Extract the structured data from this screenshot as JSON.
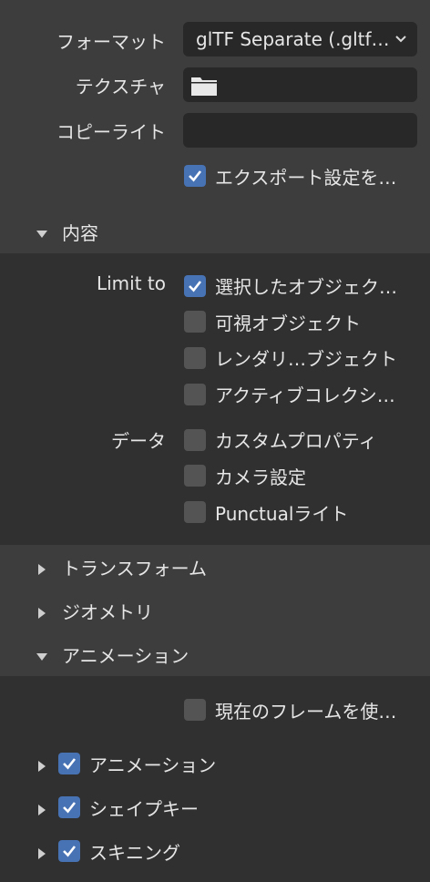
{
  "export": {
    "format_label": "フォーマット",
    "format_value": "glTF Separate (.gltf…",
    "texture_label": "テクスチャ",
    "copyright_label": "コピーライト",
    "remember_settings": {
      "label": "エクスポート設定を…",
      "checked": true
    }
  },
  "content_section": {
    "title": "内容",
    "limit_to_label": "Limit to",
    "limit_to": [
      {
        "label": "選択したオブジェク…",
        "checked": true
      },
      {
        "label": "可視オブジェクト",
        "checked": false
      },
      {
        "label": "レンダリ…ブジェクト",
        "checked": false
      },
      {
        "label": "アクティブコレクシ…",
        "checked": false
      }
    ],
    "data_label": "データ",
    "data": [
      {
        "label": "カスタムプロパティ",
        "checked": false
      },
      {
        "label": "カメラ設定",
        "checked": false
      },
      {
        "label": "Punctualライト",
        "checked": false
      }
    ]
  },
  "transform_section": {
    "title": "トランスフォーム"
  },
  "geometry_section": {
    "title": "ジオメトリ"
  },
  "animation_section": {
    "title": "アニメーション",
    "use_current_frame": {
      "label": "現在のフレームを使…",
      "checked": false
    },
    "subsections": [
      {
        "label": "アニメーション",
        "checked": true
      },
      {
        "label": "シェイプキー",
        "checked": true
      },
      {
        "label": "スキニング",
        "checked": true
      }
    ]
  },
  "colors": {
    "accent": "#4772b3",
    "panel": "#3d3d3d",
    "subpanel": "#303030",
    "field": "#282828"
  }
}
